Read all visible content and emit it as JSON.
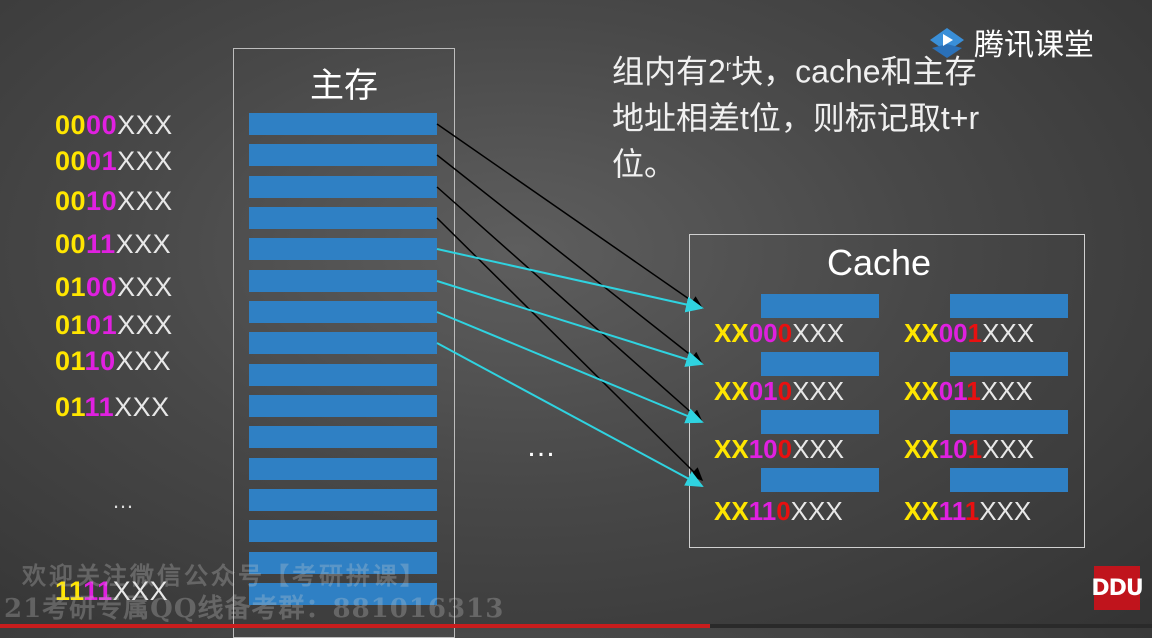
{
  "logo": {
    "brand": "腾讯课堂",
    "icon": "play-triangle-icon"
  },
  "main_memory": {
    "title": "主存"
  },
  "note": {
    "line1_a": "组内有2",
    "line1_sup": "r",
    "line1_b": "块，cache和主存",
    "line2": "地址相差t位，则标记取t+r",
    "line3": "位。"
  },
  "addresses": [
    {
      "yellow": "00",
      "magenta": "00",
      "rest": "XXX"
    },
    {
      "yellow": "00",
      "magenta": "01",
      "rest": "XXX"
    },
    {
      "yellow": "00",
      "magenta": "10",
      "rest": "XXX"
    },
    {
      "yellow": "00",
      "magenta": "11",
      "rest": "XXX"
    },
    {
      "yellow": "01",
      "magenta": "00",
      "rest": "XXX"
    },
    {
      "yellow": "01",
      "magenta": "01",
      "rest": "XXX"
    },
    {
      "yellow": "01",
      "magenta": "10",
      "rest": "XXX"
    },
    {
      "yellow": "01",
      "magenta": "11",
      "rest": "XXX"
    }
  ],
  "addresses_ellipsis": "…",
  "last_address": {
    "yellow": "11",
    "magenta": "11",
    "rest": "XXX"
  },
  "cache": {
    "title": "Cache",
    "entries": [
      {
        "tag": "XX",
        "magenta": "00",
        "red": "0",
        "rest": "XXX"
      },
      {
        "tag": "XX",
        "magenta": "00",
        "red": "1",
        "rest": "XXX"
      },
      {
        "tag": "XX",
        "magenta": "01",
        "red": "0",
        "rest": "XXX"
      },
      {
        "tag": "XX",
        "magenta": "01",
        "red": "1",
        "rest": "XXX"
      },
      {
        "tag": "XX",
        "magenta": "10",
        "red": "0",
        "rest": "XXX"
      },
      {
        "tag": "XX",
        "magenta": "10",
        "red": "1",
        "rest": "XXX"
      },
      {
        "tag": "XX",
        "magenta": "11",
        "red": "0",
        "rest": "XXX"
      },
      {
        "tag": "XX",
        "magenta": "11",
        "red": "1",
        "rest": "XXX"
      }
    ]
  },
  "middle_ellipsis": "…",
  "watermark": {
    "line1": "欢迎关注微信公众号【考研拼课】",
    "line2": "21考研专属QQ线备考群：881016313"
  },
  "badge": {
    "label": "DDU"
  },
  "colors": {
    "block": "#2f80c4",
    "arrow_black": "#000000",
    "arrow_cyan": "#2fd3e0",
    "yellow": "#ffe600",
    "magenta": "#e020e0",
    "red": "#e81010"
  }
}
